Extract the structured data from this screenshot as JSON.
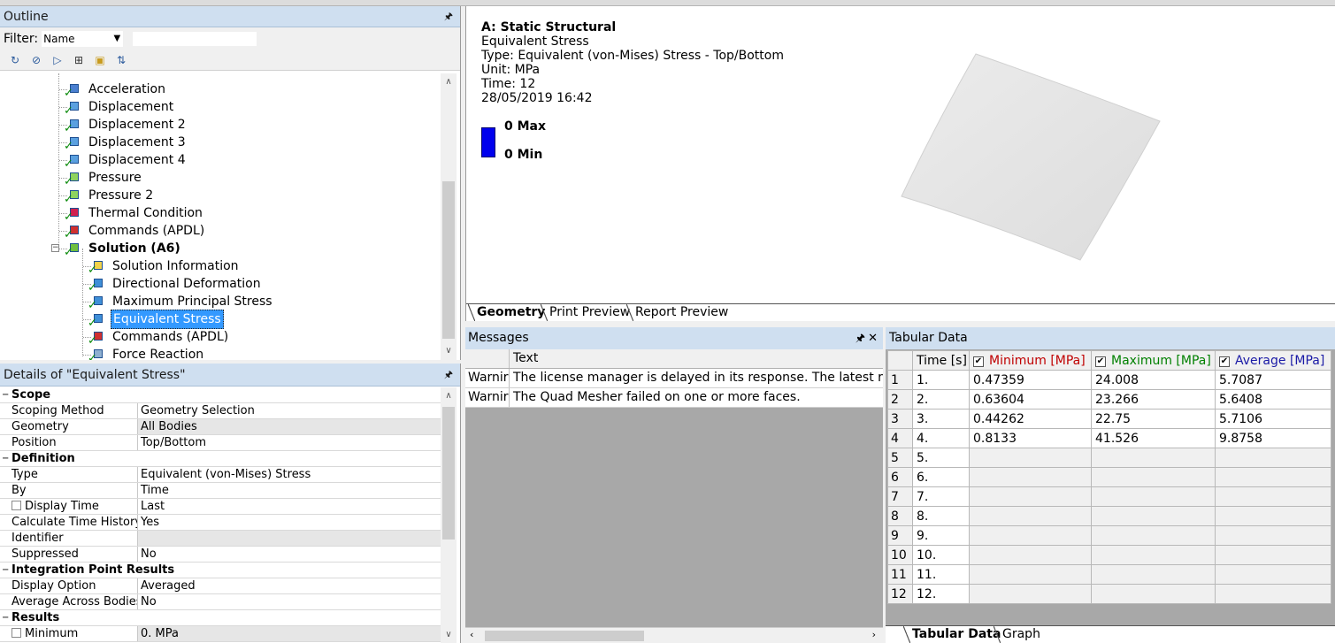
{
  "outline": {
    "title": "Outline",
    "pin_icon": "pin-icon",
    "filter_label": "Filter:",
    "filter_value": "Name",
    "tree": [
      {
        "label": "Acceleration",
        "level": 1,
        "icon": "acceleration-icon"
      },
      {
        "label": "Displacement",
        "level": 1,
        "icon": "displacement-icon"
      },
      {
        "label": "Displacement 2",
        "level": 1,
        "icon": "displacement-icon"
      },
      {
        "label": "Displacement 3",
        "level": 1,
        "icon": "displacement-icon"
      },
      {
        "label": "Displacement 4",
        "level": 1,
        "icon": "displacement-icon"
      },
      {
        "label": "Pressure",
        "level": 1,
        "icon": "pressure-icon"
      },
      {
        "label": "Pressure 2",
        "level": 1,
        "icon": "pressure-icon"
      },
      {
        "label": "Thermal Condition",
        "level": 1,
        "icon": "thermal-icon"
      },
      {
        "label": "Commands (APDL)",
        "level": 1,
        "icon": "commands-icon"
      },
      {
        "label": "Solution (A6)",
        "level": 0,
        "icon": "solution-icon",
        "bold": true
      },
      {
        "label": "Solution Information",
        "level": 2,
        "icon": "info-icon"
      },
      {
        "label": "Directional Deformation",
        "level": 2,
        "icon": "result-icon"
      },
      {
        "label": "Maximum Principal Stress",
        "level": 2,
        "icon": "result-icon"
      },
      {
        "label": "Equivalent Stress",
        "level": 2,
        "icon": "result-icon",
        "selected": true
      },
      {
        "label": "Commands (APDL)",
        "level": 2,
        "icon": "commands-icon"
      },
      {
        "label": "Force Reaction",
        "level": 2,
        "icon": "probe-icon"
      }
    ]
  },
  "details": {
    "title": "Details of \"Equivalent Stress\"",
    "rows": [
      {
        "cat": "Scope"
      },
      {
        "k": "Scoping Method",
        "v": "Geometry Selection"
      },
      {
        "k": "Geometry",
        "v": "All Bodies",
        "gray": true
      },
      {
        "k": "Position",
        "v": "Top/Bottom"
      },
      {
        "cat": "Definition"
      },
      {
        "k": "Type",
        "v": "Equivalent (von-Mises) Stress"
      },
      {
        "k": "By",
        "v": "Time"
      },
      {
        "k": "Display Time",
        "v": "Last",
        "checkbox": true
      },
      {
        "k": "Calculate Time History",
        "v": "Yes"
      },
      {
        "k": "Identifier",
        "v": "",
        "gray": true
      },
      {
        "k": "Suppressed",
        "v": "No"
      },
      {
        "cat": "Integration Point Results"
      },
      {
        "k": "Display Option",
        "v": "Averaged"
      },
      {
        "k": "Average Across Bodies",
        "v": "No"
      },
      {
        "cat": "Results"
      },
      {
        "k": "Minimum",
        "v": "0. MPa",
        "checkbox": true,
        "gray": true
      }
    ]
  },
  "viewport": {
    "lines": [
      "A: Static Structural",
      "Equivalent Stress",
      "Type: Equivalent (von-Mises) Stress - Top/Bottom",
      "Unit: MPa",
      "Time: 12",
      "28/05/2019 16:42"
    ],
    "legend_max": "0 Max",
    "legend_min": "0 Min",
    "legend_color": "#0000ee",
    "tabs": [
      "Geometry",
      "Print Preview",
      "Report Preview"
    ]
  },
  "messages": {
    "title": "Messages",
    "col_text": "Text",
    "rows": [
      {
        "type": "Warnir",
        "text": "The license manager is delayed in its response. The latest reque"
      },
      {
        "type": "Warnir",
        "text": "The Quad Mesher failed on one or more faces."
      }
    ]
  },
  "tabular": {
    "title": "Tabular Data",
    "headers": {
      "time": "Time [s]",
      "min": "Minimum [MPa]",
      "max": "Maximum [MPa]",
      "avg": "Average [MPa]"
    },
    "colors": {
      "min": "#c00000",
      "max": "#008000",
      "avg": "#1a1aa6"
    },
    "rows": [
      {
        "i": "1",
        "t": "1.",
        "min": "0.47359",
        "max": "24.008",
        "avg": "5.7087"
      },
      {
        "i": "2",
        "t": "2.",
        "min": "0.63604",
        "max": "23.266",
        "avg": "5.6408"
      },
      {
        "i": "3",
        "t": "3.",
        "min": "0.44262",
        "max": "22.75",
        "avg": "5.7106"
      },
      {
        "i": "4",
        "t": "4.",
        "min": "0.8133",
        "max": "41.526",
        "avg": "9.8758"
      },
      {
        "i": "5",
        "t": "5.",
        "min": "",
        "max": "",
        "avg": ""
      },
      {
        "i": "6",
        "t": "6.",
        "min": "",
        "max": "",
        "avg": ""
      },
      {
        "i": "7",
        "t": "7.",
        "min": "",
        "max": "",
        "avg": ""
      },
      {
        "i": "8",
        "t": "8.",
        "min": "",
        "max": "",
        "avg": ""
      },
      {
        "i": "9",
        "t": "9.",
        "min": "",
        "max": "",
        "avg": ""
      },
      {
        "i": "10",
        "t": "10.",
        "min": "",
        "max": "",
        "avg": ""
      },
      {
        "i": "11",
        "t": "11.",
        "min": "",
        "max": "",
        "avg": ""
      },
      {
        "i": "12",
        "t": "12.",
        "min": "",
        "max": "",
        "avg": ""
      }
    ],
    "tabs": [
      "Tabular Data",
      "Graph"
    ]
  }
}
